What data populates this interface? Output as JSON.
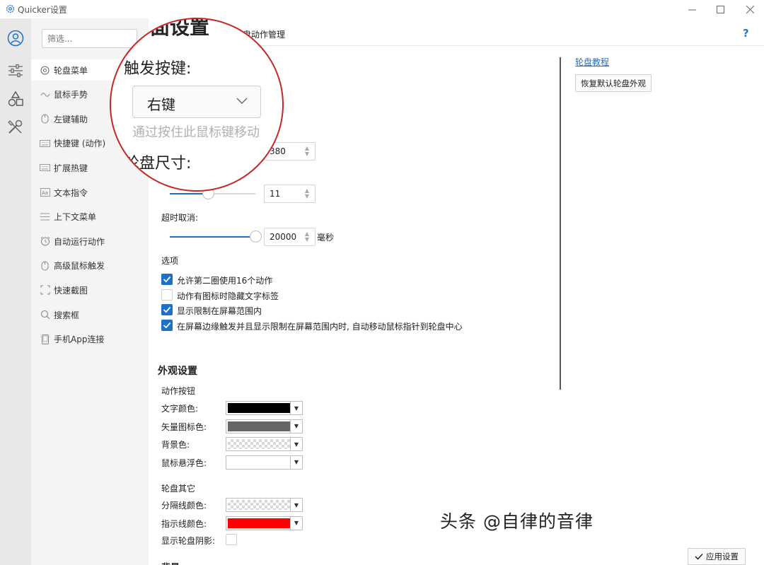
{
  "window": {
    "title": "Quicker设置"
  },
  "rail": {
    "icons": [
      "user-icon",
      "sliders-icon",
      "shapes-icon",
      "tools-icon"
    ]
  },
  "nav": {
    "filter_placeholder": "筛选...",
    "items": [
      {
        "label": "轮盘菜单",
        "icon": "wheel-icon"
      },
      {
        "label": "鼠标手势",
        "icon": "wave-icon"
      },
      {
        "label": "左键辅助",
        "icon": "mouse-icon"
      },
      {
        "label": "快捷键 (动作)",
        "icon": "keyboard-icon"
      },
      {
        "label": "扩展热键",
        "icon": "keyboard-icon"
      },
      {
        "label": "文本指令",
        "icon": "text-icon"
      },
      {
        "label": "上下文菜单",
        "icon": "menu-icon"
      },
      {
        "label": "自动运行动作",
        "icon": "alarm-icon"
      },
      {
        "label": "高级鼠标触发",
        "icon": "mouse-icon"
      },
      {
        "label": "快速截图",
        "icon": "crop-icon"
      },
      {
        "label": "搜索框",
        "icon": "search-icon"
      },
      {
        "label": "手机App连接",
        "icon": "phone-icon"
      }
    ]
  },
  "header": {
    "tab_label": "盘动作管理",
    "help": "?"
  },
  "magnifier": {
    "title_fragment": "面设置",
    "trigger_label": "触发按键:",
    "trigger_value": "右键",
    "hint": "通过按住此鼠标键移动",
    "size_label": "轮盘尺寸:"
  },
  "settings": {
    "size_value": "380",
    "slider2_value": "11",
    "slider2_level": 0.45,
    "timeout_label": "超时取消:",
    "timeout_value": "20000",
    "timeout_unit": "毫秒",
    "timeout_level": 1.0,
    "options_title": "选项",
    "options": [
      {
        "label": "允许第二圈使用16个动作",
        "checked": true
      },
      {
        "label": "动作有图标时隐藏文字标签",
        "checked": false
      },
      {
        "label": "显示限制在屏幕范围内",
        "checked": true
      },
      {
        "label": "在屏幕边缘触发并且显示限制在屏幕范围内时, 自动移动鼠标指针到轮盘中心",
        "checked": true
      }
    ]
  },
  "side": {
    "tutorial_link": "轮盘教程",
    "restore_button": "恢复默认轮盘外观"
  },
  "appearance": {
    "title": "外观设置",
    "action_button_title": "动作按钮",
    "colors": [
      {
        "label": "文字颜色:",
        "color": "#000000"
      },
      {
        "label": "矢量图标色:",
        "color": "#666666"
      },
      {
        "label": "背景色:",
        "color": "transparent"
      },
      {
        "label": "鼠标悬浮色:",
        "color": "#ffffff"
      }
    ],
    "wheel_other_title": "轮盘其它",
    "other_colors": [
      {
        "label": "分隔线颜色:",
        "color": "transparent"
      },
      {
        "label": "指示线颜色:",
        "color": "#ff0000"
      }
    ],
    "shadow_label": "显示轮盘阴影:",
    "next_section_fragment": "背景"
  },
  "footer": {
    "apply_button": "应用设置"
  },
  "watermark": "头条 @自律的音律"
}
